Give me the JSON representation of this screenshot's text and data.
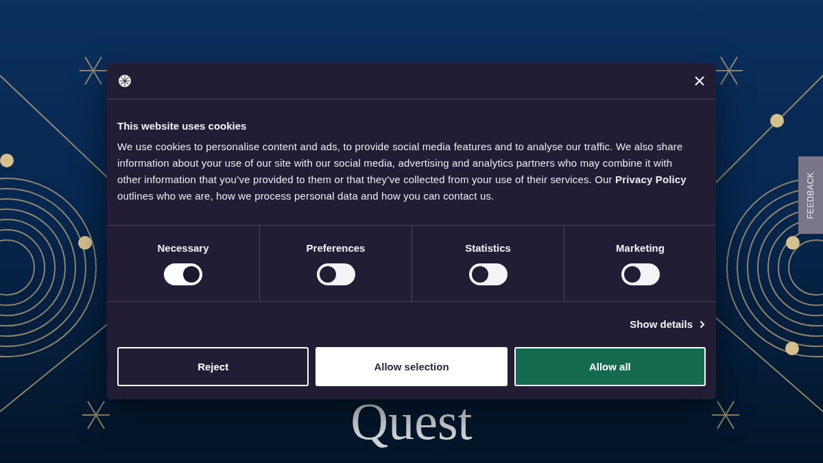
{
  "page": {
    "heading": "Quest"
  },
  "feedback_tab": {
    "label": "FEEDBACK"
  },
  "cookie_dialog": {
    "title": "This website uses cookies",
    "body": "We use cookies to personalise content and ads, to provide social media features and to analyse our traffic. We also share information about your use of our site with our social media, advertising and analytics partners who may combine it with other information that you’ve provided to them or that they’ve collected from your use of their services. Our **Privacy Policy** outlines who we are, how we process personal data and how you can contact us.",
    "categories": [
      {
        "label": "Necessary",
        "checked": true
      },
      {
        "label": "Preferences",
        "checked": false
      },
      {
        "label": "Statistics",
        "checked": false
      },
      {
        "label": "Marketing",
        "checked": false
      }
    ],
    "details_link": "Show details",
    "buttons": [
      {
        "label": "Reject",
        "kind": "outline"
      },
      {
        "label": "Allow selection",
        "kind": "light"
      },
      {
        "label": "Allow all",
        "kind": "primary"
      }
    ]
  }
}
